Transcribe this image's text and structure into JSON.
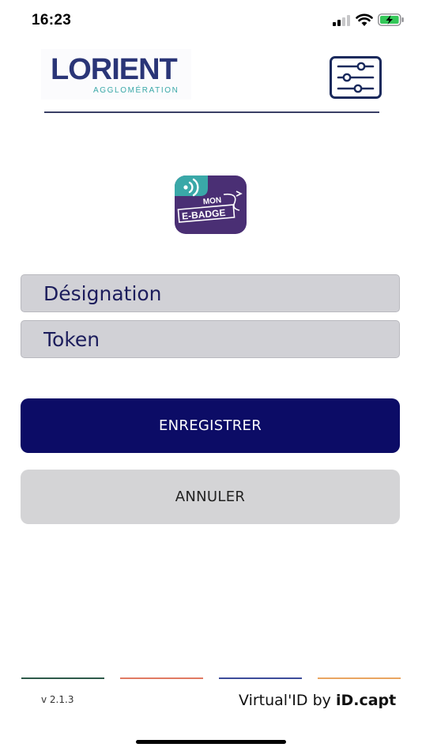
{
  "status_bar": {
    "time": "16:23"
  },
  "header": {
    "logo_main": "LORIENT",
    "logo_sub": "AGGLOMÉRATION",
    "settings_icon": "sliders-icon"
  },
  "app_icon": {
    "line1": "MON",
    "line2": "E-BADGE"
  },
  "form": {
    "designation_placeholder": "Désignation",
    "token_placeholder": "Token"
  },
  "buttons": {
    "save_label": "ENREGISTRER",
    "cancel_label": "ANNULER"
  },
  "footer": {
    "version": "v 2.1.3",
    "brand_prefix": "Virtual'ID by ",
    "brand_name": "iD.capt",
    "line_colors": [
      "#2e5a4a",
      "#e07a63",
      "#3d4c9a",
      "#e9a561"
    ]
  },
  "colors": {
    "primary": "#0c0c66",
    "field_bg": "#d1d1d6",
    "cancel_bg": "#d4d4d6",
    "app_icon_bg": "#4a2f74",
    "app_icon_accent": "#3aa8a8"
  }
}
